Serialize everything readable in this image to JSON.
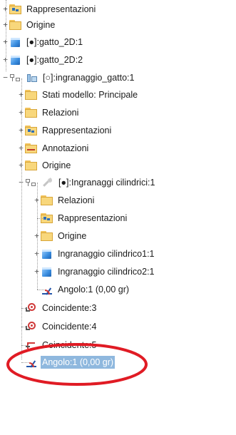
{
  "browser_tree": {
    "nodes": [
      {
        "id": "n0",
        "label": "Rappresentazioni",
        "icon": "representations-folder-icon",
        "expand": "+"
      },
      {
        "id": "n1",
        "label": "Origine",
        "icon": "folder-icon",
        "expand": "+"
      },
      {
        "id": "n2",
        "label": "[●]:gatto_2D:1",
        "icon": "part-2d-icon",
        "expand": "+"
      },
      {
        "id": "n3",
        "label": "[●]:gatto_2D:2",
        "icon": "part-icon",
        "expand": "+"
      },
      {
        "id": "n4",
        "label": "[○]:ingranaggio_gatto:1",
        "icon": "assembly-icon",
        "expand": "−"
      },
      {
        "id": "n5",
        "label": "Stati modello: Principale",
        "icon": "folder-icon",
        "expand": "+"
      },
      {
        "id": "n6",
        "label": "Relazioni",
        "icon": "folder-icon",
        "expand": "+"
      },
      {
        "id": "n7",
        "label": "Rappresentazioni",
        "icon": "representations-folder-icon",
        "expand": "+"
      },
      {
        "id": "n8",
        "label": "Annotazioni",
        "icon": "annotations-folder-icon",
        "expand": "+"
      },
      {
        "id": "n9",
        "label": "Origine",
        "icon": "folder-icon",
        "expand": "+"
      },
      {
        "id": "n10",
        "label": "[●]:Ingranaggi cilindrici:1",
        "icon": "gear-generator-icon",
        "expand": "−"
      },
      {
        "id": "n11",
        "label": "Relazioni",
        "icon": "folder-icon",
        "expand": "+"
      },
      {
        "id": "n12",
        "label": "Rappresentazioni",
        "icon": "representations-folder-icon",
        "expand": ""
      },
      {
        "id": "n13",
        "label": "Origine",
        "icon": "folder-icon",
        "expand": "+"
      },
      {
        "id": "n14",
        "label": "Ingranaggio cilindrico1:1",
        "icon": "part-icon",
        "expand": "+"
      },
      {
        "id": "n15",
        "label": "Ingranaggio cilindrico2:1",
        "icon": "part-icon",
        "expand": "+"
      },
      {
        "id": "n16",
        "label": "Angolo:1 (0,00 gr)",
        "icon": "angle-constraint-icon",
        "expand": ""
      },
      {
        "id": "n17",
        "label": "Coincidente:3",
        "icon": "coincident-constraint-icon",
        "expand": ""
      },
      {
        "id": "n18",
        "label": "Coincidente:4",
        "icon": "coincident-constraint-icon",
        "expand": ""
      },
      {
        "id": "n19",
        "label": "Coincidente:5",
        "icon": "coincident-constraint-icon",
        "expand": ""
      },
      {
        "id": "n20",
        "label": "Angolo:1 (0,00 gr)",
        "icon": "angle-constraint-icon",
        "expand": "",
        "selected": true
      }
    ]
  },
  "colors": {
    "selection_bg": "#8fb8de",
    "highlight_ellipse": "#e01b24",
    "folder": "#f8d77c"
  }
}
